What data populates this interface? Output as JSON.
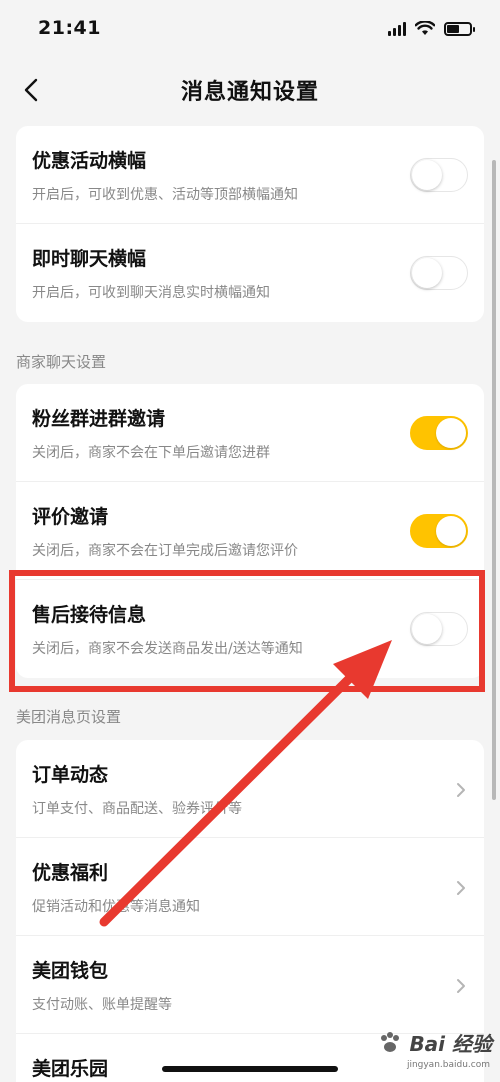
{
  "status_bar": {
    "time": "21:41"
  },
  "nav": {
    "title": "消息通知设置"
  },
  "banner_settings": [
    {
      "title": "优惠活动横幅",
      "desc": "开启后，可收到优惠、活动等顶部横幅通知",
      "enabled": false
    },
    {
      "title": "即时聊天横幅",
      "desc": "开启后，可收到聊天消息实时横幅通知",
      "enabled": false
    }
  ],
  "merchant_chat": {
    "section_label": "商家聊天设置",
    "items": [
      {
        "title": "粉丝群进群邀请",
        "desc": "关闭后，商家不会在下单后邀请您进群",
        "enabled": true
      },
      {
        "title": "评价邀请",
        "desc": "关闭后，商家不会在订单完成后邀请您评价",
        "enabled": true
      },
      {
        "title": "售后接待信息",
        "desc": "关闭后，商家不会发送商品发出/送达等通知",
        "enabled": false
      }
    ]
  },
  "meituan_page": {
    "section_label": "美团消息页设置",
    "items": [
      {
        "title": "订单动态",
        "desc": "订单支付、商品配送、验券评价等"
      },
      {
        "title": "优惠福利",
        "desc": "促销活动和优惠等消息通知"
      },
      {
        "title": "美团钱包",
        "desc": "支付动账、账单提醒等"
      },
      {
        "title": "美团乐园",
        "desc": ""
      }
    ]
  },
  "watermark": {
    "text": "Bai 经验",
    "sub": "jingyan.baidu.com"
  },
  "colors": {
    "accent": "#ffc300",
    "annotation_red": "#e8392f",
    "background": "#f4f4f4"
  },
  "icons": {
    "back": "chevron-left-icon",
    "row_arrow": "chevron-right-icon"
  }
}
